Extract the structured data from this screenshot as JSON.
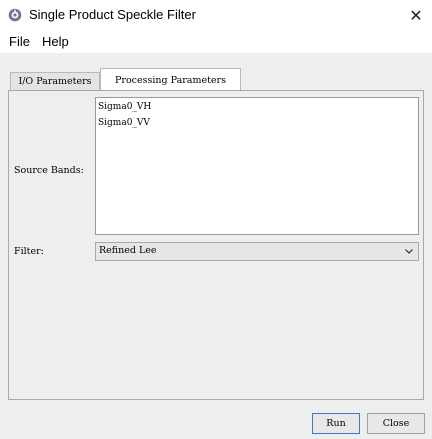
{
  "window": {
    "title": "Single Product Speckle Filter",
    "close_symbol": "✕",
    "icon": "snap-gear-icon"
  },
  "menu": [
    {
      "label": "File"
    },
    {
      "label": "Help"
    }
  ],
  "tabs": [
    {
      "label": "I/O Parameters",
      "active": false
    },
    {
      "label": "Processing Parameters",
      "active": true
    }
  ],
  "form": {
    "source_bands_label": "Source Bands:",
    "source_bands": [
      "Sigma0_VH",
      "Sigma0_VV"
    ],
    "filter_label": "Filter:",
    "filter_value": "Refined Lee"
  },
  "buttons": {
    "run": "Run",
    "close": "Close"
  },
  "colors": {
    "accent": "#3b78c8",
    "panel_bg": "#eeeeee"
  }
}
